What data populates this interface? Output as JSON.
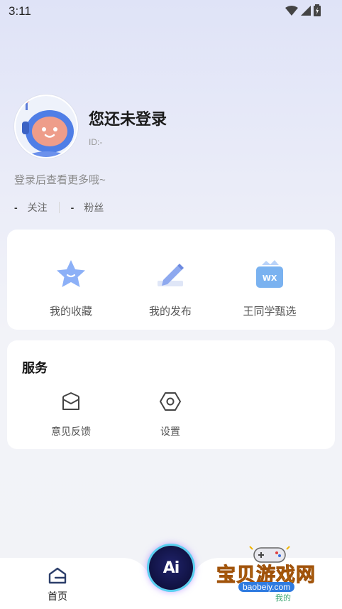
{
  "status_bar": {
    "time": "3:11"
  },
  "profile": {
    "username": "您还未登录",
    "user_id": "ID:-",
    "hint": "登录后查看更多哦~",
    "stats": [
      {
        "value": "-",
        "label": "关注"
      },
      {
        "value": "-",
        "label": "粉丝"
      }
    ]
  },
  "quick_actions": [
    {
      "label": "我的收藏",
      "icon": "star-icon"
    },
    {
      "label": "我的发布",
      "icon": "pencil-icon"
    },
    {
      "label": "王同学甄选",
      "icon": "shop-basket-icon"
    }
  ],
  "services": {
    "title": "服务",
    "items": [
      {
        "label": "意见反馈",
        "icon": "feedback-envelope-icon"
      },
      {
        "label": "设置",
        "icon": "settings-hexagon-icon"
      }
    ]
  },
  "bottom_nav": {
    "home_label": "首页",
    "ai_label": "Ai"
  },
  "watermark": {
    "title": "宝贝游戏网",
    "url": "baobeiy.com",
    "sub": "我的"
  },
  "colors": {
    "accent_blue": "#5b8cf0",
    "icon_blue": "#7aa4f5",
    "text_dark": "#1b1b1b"
  }
}
